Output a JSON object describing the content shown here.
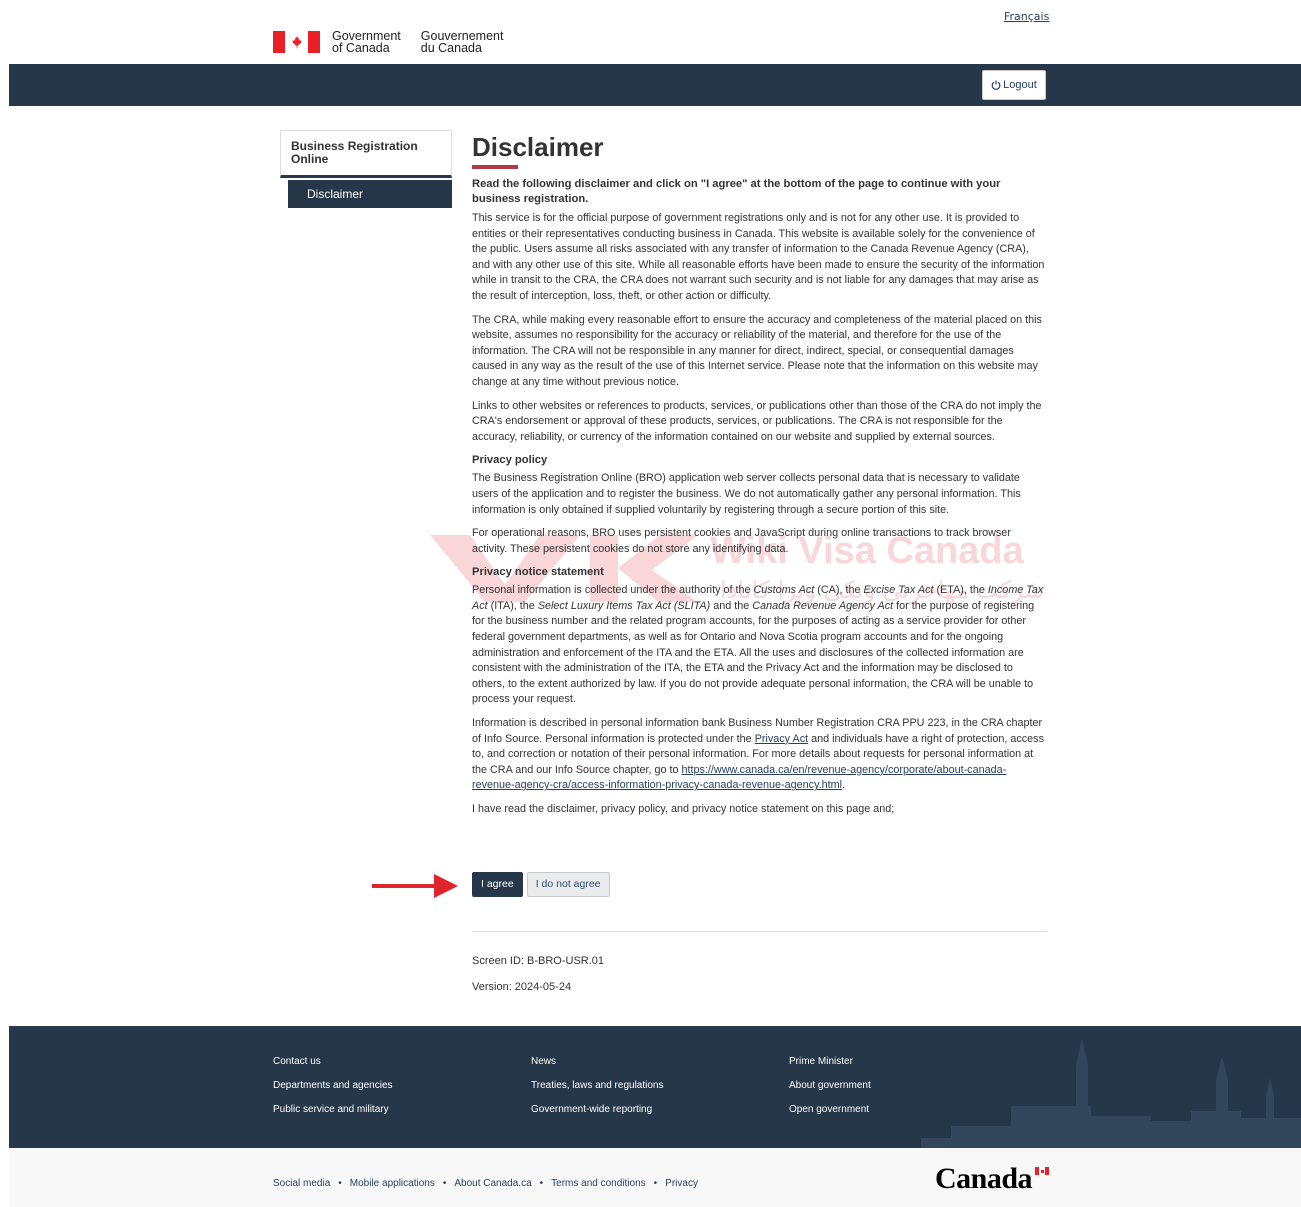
{
  "header": {
    "language_link": "Français",
    "gov_en_line1": "Government",
    "gov_en_line2": "of Canada",
    "gov_fr_line1": "Gouvernement",
    "gov_fr_line2": "du Canada",
    "logout_label": "Logout",
    "logout_icon": "power-icon"
  },
  "sidebar": {
    "title": "Business Registration Online",
    "items": [
      {
        "label": "Disclaimer",
        "active": true
      }
    ]
  },
  "main": {
    "title": "Disclaimer",
    "lead": "Read the following disclaimer and click on \"I agree\" at the bottom of the page to continue with your business registration.",
    "para1": "This service is for the official purpose of government registrations only and is not for any other use. It is provided to entities or their representatives conducting business in Canada. This website is available solely for the convenience of the public. Users assume all risks associated with any transfer of information to the Canada Revenue Agency (CRA), and with any other use of this site. While all reasonable efforts have been made to ensure the security of the information while in transit to the CRA, the CRA does not warrant such security and is not liable for any damages that may arise as the result of interception, loss, theft, or other action or difficulty.",
    "para2": "The CRA, while making every reasonable effort to ensure the accuracy and completeness of the material placed on this website, assumes no responsibility for the accuracy or reliability of the material, and therefore for the use of the information. The CRA will not be responsible in any manner for direct, indirect, special, or consequential damages caused in any way as the result of the use of this Internet service. Please note that the information on this website may change at any time without previous notice.",
    "para3": "Links to other websites or references to products, services, or publications other than those of the CRA do not imply the CRA's endorsement or approval of these products, services, or publications. The CRA is not responsible for the accuracy, reliability, or currency of the information contained on our website and supplied by external sources.",
    "privacy_policy_heading": "Privacy policy",
    "privacy_para1": "The Business Registration Online (BRO) application web server collects personal data that is necessary to validate users of the application and to register the business. We do not automatically gather any personal information. This information is only obtained if supplied voluntarily by registering through a secure portion of this site.",
    "privacy_para2": "For operational reasons, BRO uses persistent cookies and JavaScript during online transactions to track browser activity. These persistent cookies do not store any identifying data.",
    "privacy_notice_heading": "Privacy notice statement",
    "notice_p1_a": "Personal information is collected under the authority of the ",
    "notice_p1_customs": "Customs Act",
    "notice_p1_b": " (CA), the ",
    "notice_p1_excise": "Excise Tax Act",
    "notice_p1_c": " (ETA), the ",
    "notice_p1_income": "Income Tax Act",
    "notice_p1_d": " (ITA), the ",
    "notice_p1_luxury": "Select Luxury Items Tax Act (SLITA)",
    "notice_p1_e": " and the ",
    "notice_p1_cra": "Canada Revenue Agency Act",
    "notice_p1_f": " for the purpose of registering for the business number and the related program accounts, for the purposes of acting as a service provider for other federal government departments, as well as for Ontario and Nova Scotia program accounts and for the ongoing administration and enforcement of the ITA and the ETA. All the uses and disclosures of the collected information are consistent with the administration of the ITA, the ETA and the Privacy Act and the information may be disclosed to others, to the extent authorized by law. If you do not provide adequate personal information, the CRA will be unable to process your request.",
    "notice_p2_a": "Information is described in personal information bank Business Number Registration CRA PPU 223, in the CRA chapter of Info Source. Personal information is protected under the ",
    "notice_p2_link": "Privacy Act",
    "notice_p2_b": " and individuals have a right of protection, access to, and correction or notation of their personal information. For more details about requests for personal information at the CRA and our Info Source chapter, go to ",
    "notice_p2_url": "https://www.canada.ca/en/revenue-agency/corporate/about-canada-revenue-agency-cra/access-information-privacy-canada-revenue-agency.html",
    "notice_p2_c": ".",
    "acknowledge": "I have read the disclaimer, privacy policy, and privacy notice statement on this page and;",
    "agree_button": "I agree",
    "disagree_button": "I do not agree",
    "screen_id": "Screen ID: B-BRO-USR.01",
    "version": "Version: 2024-05-24"
  },
  "watermark": {
    "line1": "Wiki Visa Canada",
    "line2": "شرکت مهاجرتی ویکی ویزا کانادا"
  },
  "footer": {
    "col1": [
      "Contact us",
      "Departments and agencies",
      "Public service and military"
    ],
    "col2": [
      "News",
      "Treaties, laws and regulations",
      "Government-wide reporting"
    ],
    "col3": [
      "Prime Minister",
      "About government",
      "Open government"
    ],
    "bottom_links": [
      "Social media",
      "Mobile applications",
      "About Canada.ca",
      "Terms and conditions",
      "Privacy"
    ],
    "wordmark": "Canada"
  },
  "colors": {
    "nav_bg": "#26374a",
    "accent_red": "#af3c43",
    "flag_red": "#ea1f27",
    "link": "#284162",
    "annotation_arrow": "#e0242b"
  }
}
